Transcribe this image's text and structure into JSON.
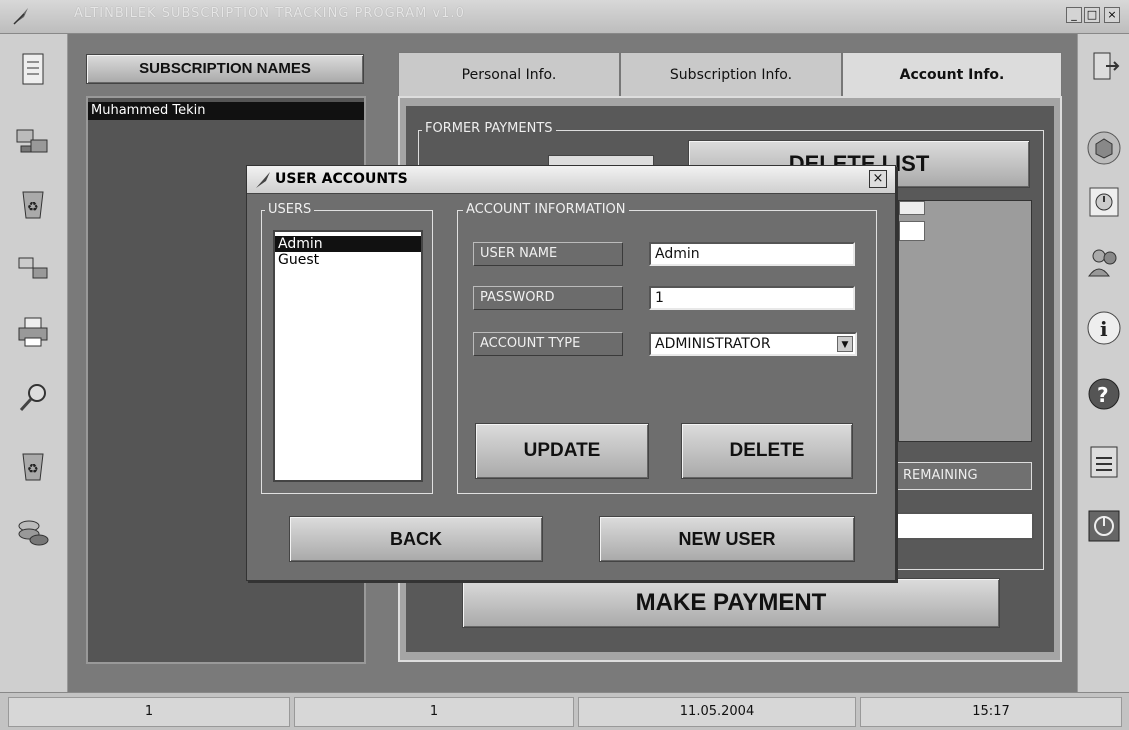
{
  "window": {
    "title": "ALTINBILEK SUBSCRIPTION TRACKING PROGRAM v1.0",
    "controls": [
      "_",
      "□",
      "×"
    ]
  },
  "left_toolbar": [
    "notepad-icon",
    "computers-icon",
    "recycle-icon",
    "network-icon",
    "printer-icon",
    "search-icon",
    "recycle-icon",
    "coins-icon"
  ],
  "right_toolbar": [
    "exit-door-icon",
    "cube-icon",
    "alarm-icon",
    "users-icon",
    "info-icon",
    "help-icon",
    "list-icon",
    "power-icon"
  ],
  "names_panel": {
    "header": "SUBSCRIPTION NAMES",
    "items": [
      "Muhammed Tekin"
    ]
  },
  "tabs": [
    {
      "label": "Personal Info."
    },
    {
      "label": "Subscription Info."
    },
    {
      "label": "Account Info."
    }
  ],
  "account_tab": {
    "former_payments_label": "FORMER PAYMENTS",
    "delete_list_label": "DELETE LIST",
    "remaining_label": "REMAINING",
    "make_payment_label": "MAKE PAYMENT"
  },
  "dialog": {
    "title": "USER ACCOUNTS",
    "close": "×",
    "users_group": "USERS",
    "users": [
      {
        "name": "Admin",
        "selected": true
      },
      {
        "name": "Guest",
        "selected": false
      }
    ],
    "account_group": "ACCOUNT INFORMATION",
    "fields": {
      "user_name_label": "USER NAME",
      "user_name_value": "Admin",
      "password_label": "PASSWORD",
      "password_value": "1",
      "account_type_label": "ACCOUNT TYPE",
      "account_type_value": "ADMINISTRATOR"
    },
    "buttons": {
      "update": "UPDATE",
      "delete": "DELETE",
      "back": "BACK",
      "new_user": "NEW USER"
    }
  },
  "status_bar": [
    "1",
    "1",
    "11.05.2004",
    "15:17"
  ]
}
